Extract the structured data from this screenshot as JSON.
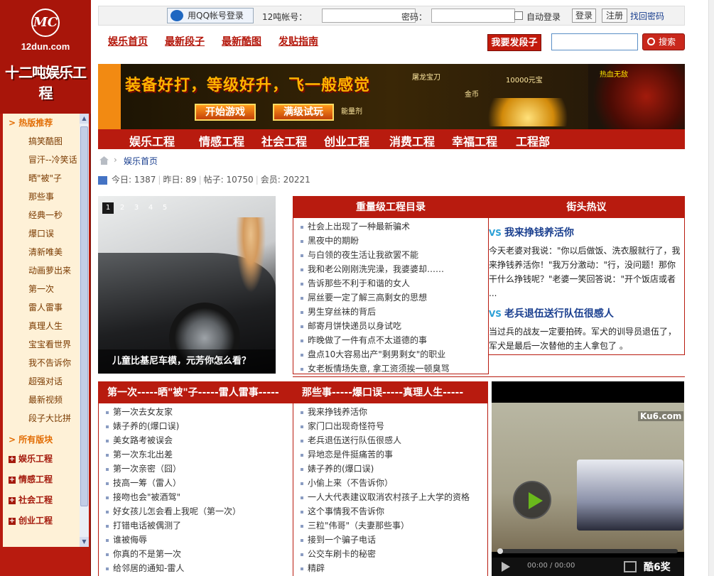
{
  "site": {
    "domain": "12dun.com",
    "name": "十二吨娱乐工程"
  },
  "topbar": {
    "qq_login": "用QQ帐号登录",
    "account_label": "12吨帐号：",
    "password_label": "密码：",
    "auto_login": "自动登录",
    "login": "登录",
    "register": "注册",
    "forgot": "找回密码"
  },
  "nav1": [
    "娱乐首页",
    "最新段子",
    "最新酷图",
    "发贴指南"
  ],
  "post_button": "我要发段子",
  "search": {
    "button": "搜索"
  },
  "banner": {
    "slogan": "装备好打，等级好升，飞一般感觉",
    "btn1": "开始游戏",
    "btn2": "满级试玩",
    "tags": [
      "屠龙宝刀",
      "10000元宝",
      "金币",
      "能量剂",
      "热血无敌"
    ]
  },
  "nav2": [
    "娱乐工程",
    "情感工程",
    "社会工程",
    "创业工程",
    "消费工程",
    "幸福工程",
    "工程部"
  ],
  "breadcrumb": "娱乐首页",
  "stats": {
    "today": "今日: 1387",
    "yesterday": "昨日: 89",
    "posts": "帖子: 10750",
    "members": "会员: 20221"
  },
  "sidebar": {
    "hot_title": "> 热版推荐",
    "hot_items": [
      "搞笑酷图",
      "冒汗--冷笑话",
      "晒\"被\"子",
      "那些事",
      "经典一秒",
      "爆口误",
      "清新唯美",
      "动画萝出来",
      "第一次",
      "雷人雷事",
      "真理人生",
      "宝宝看世界",
      "我不告诉你",
      "超强对话",
      "最新视频",
      "段子大比拼"
    ],
    "all_title": "> 所有版块",
    "groups": [
      "娱乐工程",
      "情感工程",
      "社会工程",
      "创业工程"
    ]
  },
  "slide": {
    "pages": [
      "1",
      "2",
      "3",
      "4",
      "5"
    ],
    "caption": "儿童比基尼车模，元芳你怎么看？"
  },
  "box1": {
    "title": "重量级工程目录",
    "items": [
      "社会上出现了一种最新骗术",
      "黑夜中的期盼",
      "与白领的夜生活让我欲罢不能",
      "我和老公刚刚洗完澡，我婆婆却……",
      "告诉那些不利于和谐的女人",
      "屌丝要一定了解三高剩女的思想",
      "男生穿丝袜的背后",
      "邮寄月饼快递员以身试吃",
      "昨晚做了一件有点不太道德的事",
      "盘点10大容易出产\"剩男剩女\"的职业",
      "女老板情场失意, 拿工资须挨一顿臭骂"
    ]
  },
  "box2": {
    "title": "街头热议",
    "a1": {
      "title": "我来挣钱养活你",
      "text": "今天老婆对我说：\"你以后做饭、洗衣服就行了，我来挣钱养活你！\"我万分激动：\"行，没问题！那你干什么挣钱呢？\"老婆一笑回答说：\"开个饭店或者 ..."
    },
    "a2": {
      "title": "老兵退伍送行队伍很感人",
      "text": "当过兵的战友一定要拍砖。军犬的训导员退伍了，军犬是最后一次替他的主人拿包了 。"
    }
  },
  "box3": {
    "title": "第一次-----晒\"被\"子-----雷人雷事-----",
    "items": [
      "第一次去女友家",
      "婊子养的(爆口误)",
      "美女路考被误会",
      "第一次东北出差",
      "第一次亲密（囧）",
      "技高一筹（雷人）",
      "接吻也会\"被酒驾\"",
      "好女孩儿怎会看上我呢（第一次）",
      "打错电话被偶测了",
      "谁被侮辱",
      "你真的不是第一次",
      "给邻居的通知-雷人"
    ]
  },
  "box4": {
    "title": "那些事-----爆口误-----真理人生-----",
    "items": [
      "我来挣钱养活你",
      "家门口出现奇怪符号",
      "老兵退伍送行队伍很感人",
      "异地恋是件挺痛苦的事",
      "婊子养的(爆口误)",
      "小偷上来（不告诉你）",
      "一人大代表建议取消农村孩子上大学的资格",
      "这个事情我不告诉你",
      "三粒\"伟哥\"（夫妻那些事）",
      "接到一个骗子电话",
      "公交车刷卡的秘密",
      "精辟"
    ]
  },
  "video": {
    "logo": "Ku6.com",
    "time": "00:00 / 00:00",
    "brand": "酷6奖"
  }
}
